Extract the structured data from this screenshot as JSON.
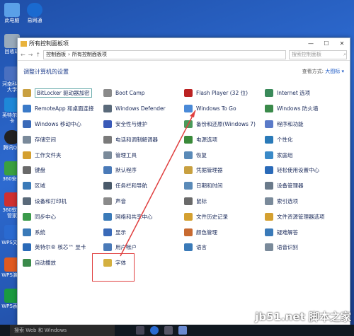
{
  "desktop": {
    "icons": [
      "此电脑",
      "易网通",
      "回收站",
      "河南科技大学",
      "英特尔显卡",
      "腾讯QQ",
      "360安全",
      "360软件管家",
      "WPS文字",
      "WPS演示",
      "WPS表格"
    ]
  },
  "window": {
    "title": "所有控制面板项",
    "controls": {
      "minimize": "—",
      "maximize": "☐",
      "close": "✕"
    },
    "breadcrumb": [
      "控制面板",
      "所有控制面板项"
    ],
    "search_placeholder": "搜索控制面板",
    "heading": "调整计算机的设置",
    "view_label": "查看方式:",
    "view_value": "大图标 ▾",
    "items": [
      {
        "label": "BitLocker 驱动器加密",
        "color": "#c9a040"
      },
      {
        "label": "Boot Camp",
        "color": "#8a8a8a"
      },
      {
        "label": "Flash Player (32 位)",
        "color": "#b22"
      },
      {
        "label": "Internet 选项",
        "color": "#3a8a5a"
      },
      {
        "label": "RemoteApp 和桌面连接",
        "color": "#3a7ac8"
      },
      {
        "label": "Windows Defender",
        "color": "#5a6a7a"
      },
      {
        "label": "Windows To Go",
        "color": "#4a8ad8"
      },
      {
        "label": "Windows 防火墙",
        "color": "#3a8a4a"
      },
      {
        "label": "Windows 移动中心",
        "color": "#3a6ab8"
      },
      {
        "label": "安全性与维护",
        "color": "#3a5ab8"
      },
      {
        "label": "备份和还原(Windows 7)",
        "color": "#4a9a5a"
      },
      {
        "label": "程序和功能",
        "color": "#5a7ac8"
      },
      {
        "label": "存储空间",
        "color": "#7a8a9a"
      },
      {
        "label": "电话和调制解调器",
        "color": "#7a7a7a"
      },
      {
        "label": "电源选项",
        "color": "#3a8a3a"
      },
      {
        "label": "个性化",
        "color": "#2a7ab8"
      },
      {
        "label": "工作文件夹",
        "color": "#d4a030"
      },
      {
        "label": "管理工具",
        "color": "#7a8a9a"
      },
      {
        "label": "恢复",
        "color": "#5a8ab8"
      },
      {
        "label": "家庭组",
        "color": "#3a8ac8"
      },
      {
        "label": "键盘",
        "color": "#6a6a6a"
      },
      {
        "label": "默认程序",
        "color": "#4a7ab8"
      },
      {
        "label": "凭据管理器",
        "color": "#c8a040"
      },
      {
        "label": "轻松使用设置中心",
        "color": "#2a6ab8"
      },
      {
        "label": "区域",
        "color": "#3a7ab8"
      },
      {
        "label": "任务栏和导航",
        "color": "#4a5a6a"
      },
      {
        "label": "日期和时间",
        "color": "#5a8ab8"
      },
      {
        "label": "设备管理器",
        "color": "#6a7a8a"
      },
      {
        "label": "设备和打印机",
        "color": "#5a6a7a"
      },
      {
        "label": "声音",
        "color": "#8a8a8a"
      },
      {
        "label": "鼠标",
        "color": "#6a6a6a"
      },
      {
        "label": "索引选项",
        "color": "#7a8a9a"
      },
      {
        "label": "同步中心",
        "color": "#3a9a4a"
      },
      {
        "label": "网络和共享中心",
        "color": "#3a7ab8"
      },
      {
        "label": "文件历史记录",
        "color": "#d4a030"
      },
      {
        "label": "文件资源管理器选项",
        "color": "#d4a030"
      },
      {
        "label": "系统",
        "color": "#3a7ab8"
      },
      {
        "label": "显示",
        "color": "#3a6ab8"
      },
      {
        "label": "颜色管理",
        "color": "#c86a30"
      },
      {
        "label": "疑难解答",
        "color": "#3a7ab8"
      },
      {
        "label": "英特尔® 核芯™ 显卡",
        "color": "#2a6ab8"
      },
      {
        "label": "用户帐户",
        "color": "#4a7ab8"
      },
      {
        "label": "语言",
        "color": "#3a7ab8"
      },
      {
        "label": "语音识别",
        "color": "#7a8a9a"
      },
      {
        "label": "自动播放",
        "color": "#3a8a4a"
      },
      {
        "label": "字体",
        "color": "#d4b040"
      }
    ]
  },
  "taskbar": {
    "search_text": "搜索 Web 和 Windows"
  },
  "watermark": {
    "main": "jb51.net",
    "brand": "脚本之家",
    "sub": "www.jb51.net"
  }
}
